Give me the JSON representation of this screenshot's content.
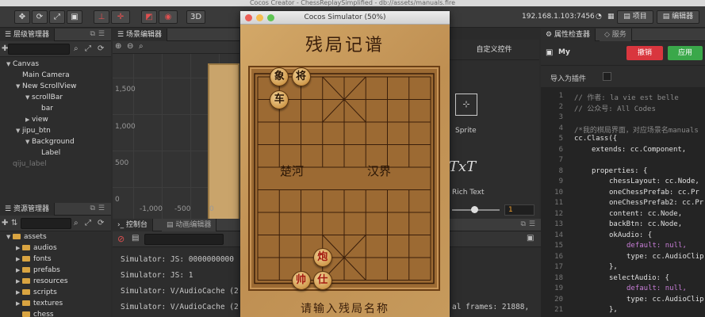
{
  "window": {
    "title": "Cocos Creator - ChessReplaySimplified - db://assets/manuals.fire"
  },
  "toolbar": {
    "btn_3d": "3D",
    "ip": "192.168.1.103:7456",
    "project_btn": "项目",
    "editor_btn": "编辑器"
  },
  "hierarchy": {
    "title": "层级管理器",
    "items": [
      {
        "label": "Canvas",
        "depth": 0,
        "caret": "▼"
      },
      {
        "label": "Main Camera",
        "depth": 1,
        "caret": ""
      },
      {
        "label": "New ScrollView",
        "depth": 1,
        "caret": "▼"
      },
      {
        "label": "scrollBar",
        "depth": 2,
        "caret": "▼"
      },
      {
        "label": "bar",
        "depth": 3,
        "caret": ""
      },
      {
        "label": "view",
        "depth": 2,
        "caret": "▶"
      },
      {
        "label": "jipu_btn",
        "depth": 1,
        "caret": "▼"
      },
      {
        "label": "Background",
        "depth": 2,
        "caret": "▼"
      },
      {
        "label": "Label",
        "depth": 3,
        "caret": ""
      },
      {
        "label": "qiju_label",
        "depth": 0,
        "caret": "",
        "dim": true
      }
    ]
  },
  "scene": {
    "title": "场景编辑器",
    "y_labels": [
      "1,500",
      "1,000",
      "500",
      "0"
    ],
    "x_labels": [
      "-1,000",
      "-500",
      "0"
    ]
  },
  "assets": {
    "title": "资源管理器",
    "items": [
      {
        "label": "assets",
        "depth": 0,
        "caret": "▼"
      },
      {
        "label": "audios",
        "depth": 1,
        "caret": "▶"
      },
      {
        "label": "fonts",
        "depth": 1,
        "caret": "▶"
      },
      {
        "label": "prefabs",
        "depth": 1,
        "caret": "▶"
      },
      {
        "label": "resources",
        "depth": 1,
        "caret": "▶"
      },
      {
        "label": "scripts",
        "depth": 1,
        "caret": "▶"
      },
      {
        "label": "textures",
        "depth": 1,
        "caret": "▶"
      },
      {
        "label": "chess",
        "depth": 1,
        "caret": ""
      }
    ]
  },
  "console": {
    "tab_console": "控制台",
    "tab_anim": "动画编辑器",
    "lines": [
      "Simulator: JS: 0000000000",
      "Simulator: JS: 1",
      "Simulator: V/AudioCache (2",
      "Simulator: V/AudioCache (2"
    ],
    "right_fragment": "al frames: 21888,"
  },
  "widgets": {
    "title": "自定义控件",
    "sprite_label": "Sprite",
    "richtext_label": "Rich Text",
    "txt_glyph": "TxT",
    "slider_value": "1"
  },
  "inspector": {
    "tab_props": "属性检查器",
    "tab_service": "服务",
    "node_name": "My",
    "revert_btn": "撤销",
    "apply_btn": "应用",
    "import_as_plugin": "导入为插件",
    "code": [
      {
        "n": "1",
        "text": "// 作者: la vie est belle",
        "color": "#8a8a8a",
        "indent": 0
      },
      {
        "n": "2",
        "text": "// 公众号: All Codes",
        "color": "#8a8a8a",
        "indent": 0
      },
      {
        "n": "3",
        "text": "",
        "color": "#ccc",
        "indent": 0
      },
      {
        "n": "4",
        "text": "/*我的棋局界面，对应场景名manuals",
        "color": "#8a8a8a",
        "indent": 0
      },
      {
        "n": "5",
        "text": "cc.Class({",
        "color": "#e0e0e0",
        "indent": 0
      },
      {
        "n": "6",
        "text": "extends: cc.Component,",
        "color": "#e0e0e0",
        "indent": 1
      },
      {
        "n": "7",
        "text": "",
        "color": "#ccc",
        "indent": 0
      },
      {
        "n": "8",
        "text": "properties: {",
        "color": "#e0e0e0",
        "indent": 1
      },
      {
        "n": "9",
        "text": "chessLayout: cc.Node,",
        "color": "#e0e0e0",
        "indent": 2
      },
      {
        "n": "10",
        "text": "oneChessPrefab: cc.Pr",
        "color": "#e0e0e0",
        "indent": 2
      },
      {
        "n": "11",
        "text": "oneChessPrefab2: cc.Pr",
        "color": "#e0e0e0",
        "indent": 2
      },
      {
        "n": "12",
        "text": "content: cc.Node,",
        "color": "#e0e0e0",
        "indent": 2
      },
      {
        "n": "13",
        "text": "backBtn: cc.Node,",
        "color": "#e0e0e0",
        "indent": 2
      },
      {
        "n": "14",
        "text": "okAudio: {",
        "color": "#e0e0e0",
        "indent": 2
      },
      {
        "n": "15",
        "text": "default: null,",
        "color": "#c77dd6",
        "indent": 3
      },
      {
        "n": "16",
        "text": "type: cc.AudioClip",
        "color": "#e0e0e0",
        "indent": 3
      },
      {
        "n": "17",
        "text": "},",
        "color": "#e0e0e0",
        "indent": 2
      },
      {
        "n": "18",
        "text": "selectAudio: {",
        "color": "#e0e0e0",
        "indent": 2
      },
      {
        "n": "19",
        "text": "default: null,",
        "color": "#c77dd6",
        "indent": 3
      },
      {
        "n": "20",
        "text": "type: cc.AudioClip",
        "color": "#e0e0e0",
        "indent": 3
      },
      {
        "n": "21",
        "text": "},",
        "color": "#e0e0e0",
        "indent": 2
      }
    ]
  },
  "simulator": {
    "title": "Cocos Simulator (50%)",
    "heading": "残局记谱",
    "river_left": "楚河",
    "river_right": "汉界",
    "prompt": "请输入残局名称",
    "pieces": [
      {
        "char": "象",
        "col": 1,
        "row": 0,
        "red": false
      },
      {
        "char": "将",
        "col": 2,
        "row": 0,
        "red": false
      },
      {
        "char": "车",
        "col": 1,
        "row": 1,
        "red": false
      },
      {
        "char": "炮",
        "col": 3,
        "row": 8,
        "red": true
      },
      {
        "char": "帅",
        "col": 2,
        "row": 9,
        "red": true
      },
      {
        "char": "仕",
        "col": 3,
        "row": 9,
        "red": true
      }
    ]
  },
  "colors": {
    "revert": "#d9363e",
    "apply": "#3aa84a",
    "accent_blue": "#2a6ed0"
  }
}
